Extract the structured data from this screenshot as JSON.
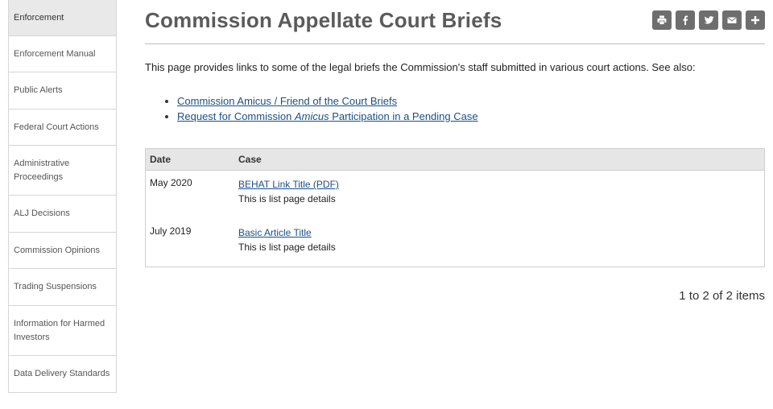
{
  "sidebar": {
    "items": [
      {
        "label": "Enforcement",
        "active": true
      },
      {
        "label": "Enforcement Manual"
      },
      {
        "label": "Public Alerts"
      },
      {
        "label": "Federal Court Actions"
      },
      {
        "label": "Administrative Proceedings"
      },
      {
        "label": "ALJ Decisions"
      },
      {
        "label": "Commission Opinions"
      },
      {
        "label": "Trading Suspensions"
      },
      {
        "label": "Information for Harmed Investors"
      },
      {
        "label": "Data Delivery Standards"
      }
    ]
  },
  "page": {
    "title": "Commission Appellate Court Briefs",
    "intro": "This page provides links to some of the legal briefs the Commission's staff submitted in various court actions. See also:"
  },
  "share": {
    "icons": [
      "print-icon",
      "facebook-icon",
      "twitter-icon",
      "email-icon",
      "plus-icon"
    ]
  },
  "links": [
    {
      "text": "Commission Amicus / Friend of the Court Briefs"
    },
    {
      "before": "Request for Commission ",
      "em": "Amicus",
      "after": " Participation in a Pending Case"
    }
  ],
  "table": {
    "headers": {
      "date": "Date",
      "case": "Case"
    },
    "rows": [
      {
        "date": "May 2020",
        "title": "BEHAT Link Title (PDF)",
        "details": "This is list page details"
      },
      {
        "date": "July 2019",
        "title": "Basic Article Title",
        "details": "This is list page details"
      }
    ]
  },
  "pager": {
    "count_text": "1 to 2 of 2 items"
  },
  "colors": {
    "link": "#1a4f8a",
    "share_button": "#6e6e6e",
    "title": "#5b5b5b"
  }
}
